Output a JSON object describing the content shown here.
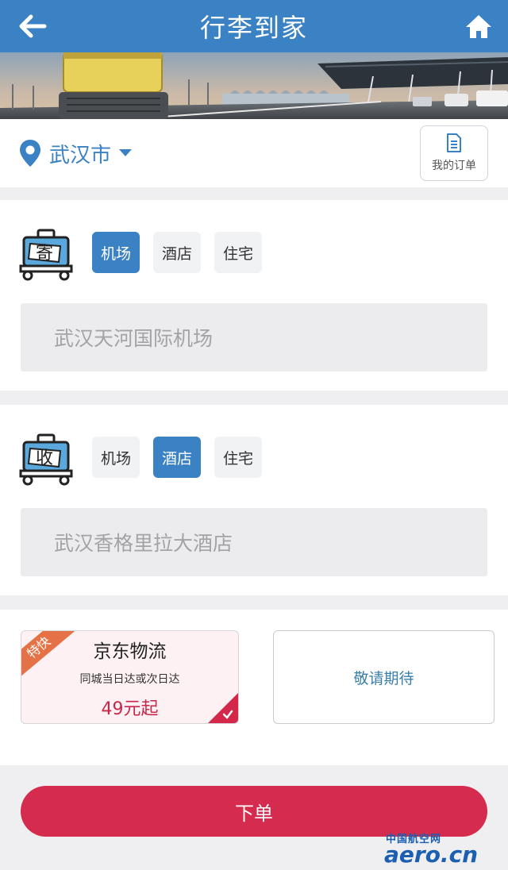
{
  "header": {
    "title": "行李到家",
    "back_icon": "arrow-left-icon",
    "home_icon": "home-icon"
  },
  "location": {
    "city": "武汉市",
    "orders_label": "我的订单"
  },
  "send": {
    "badge": "寄",
    "options": [
      "机场",
      "酒店",
      "住宅"
    ],
    "selected": "机场",
    "address": "武汉天河国际机场"
  },
  "receive": {
    "badge": "收",
    "options": [
      "机场",
      "酒店",
      "住宅"
    ],
    "selected": "酒店",
    "address": "武汉香格里拉大酒店"
  },
  "logistics": {
    "jd": {
      "ribbon": "特快",
      "title": "京东物流",
      "subtitle": "同城当日达或次日达",
      "price": "49元起",
      "selected": true
    },
    "coming_soon": "敬请期待"
  },
  "submit_label": "下单",
  "watermark": {
    "cn": "中国航空网",
    "en": "aero.cn"
  },
  "colors": {
    "primary": "#3a82c4",
    "accent": "#d42b4e",
    "ribbon": "#e57246"
  }
}
